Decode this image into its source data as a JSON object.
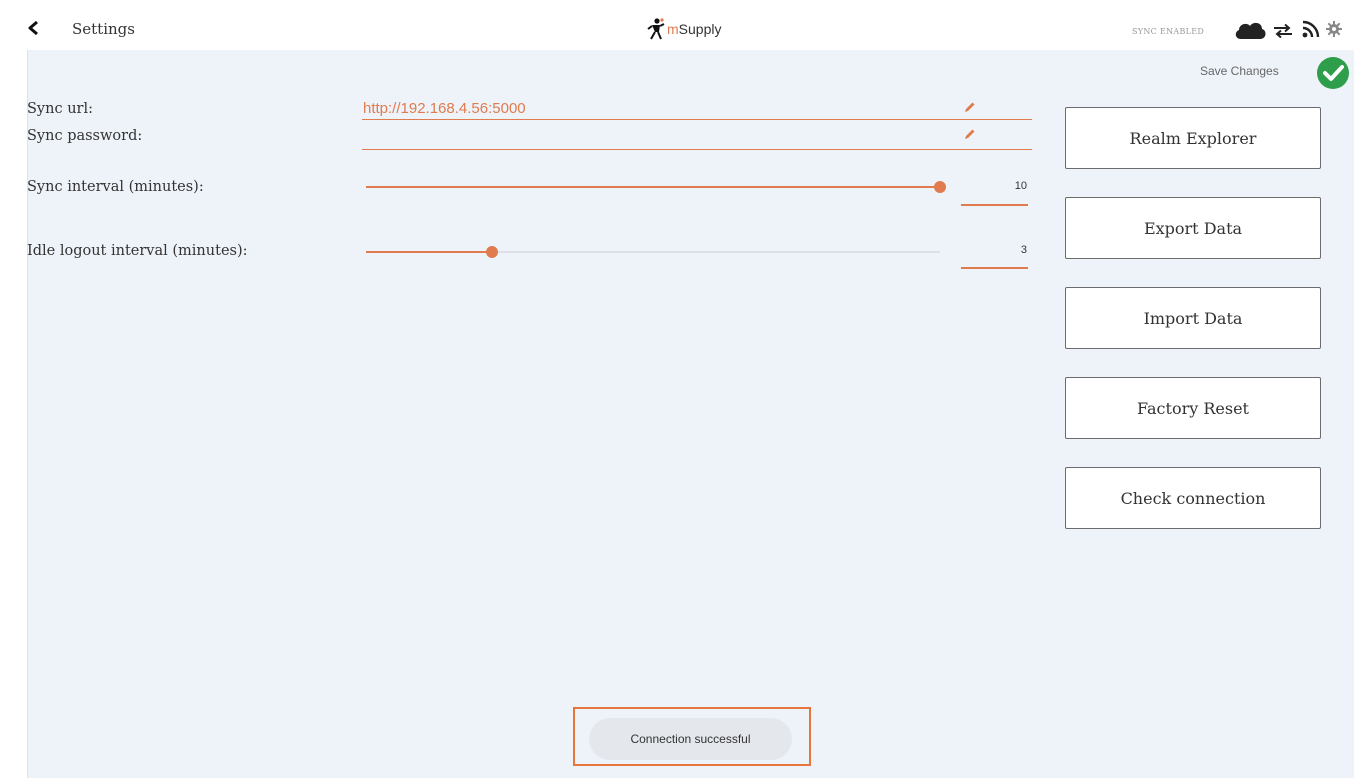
{
  "header": {
    "title": "Settings",
    "logo_m": "m",
    "logo_rest": "Supply",
    "sync_status": "SYNC ENABLED",
    "icons": [
      "back-icon",
      "mosquito-logo-icon",
      "cloud-icon",
      "swap-arrows-icon",
      "wifi-signal-icon",
      "gear-icon"
    ]
  },
  "save": {
    "label": "Save Changes",
    "icon": "check-circle-icon",
    "color": "#2e9e4a"
  },
  "form": {
    "sync_url": {
      "label": "Sync url:",
      "value": "http://192.168.4.56:5000"
    },
    "sync_password": {
      "label": "Sync password:",
      "value": ""
    },
    "sync_interval": {
      "label": "Sync interval (minutes):",
      "value": "10",
      "slider_fraction": 1.0
    },
    "idle_logout": {
      "label": "Idle logout interval (minutes):",
      "value": "3",
      "slider_fraction": 0.22
    }
  },
  "buttons": {
    "realm_explorer": "Realm Explorer",
    "export_data": "Export Data",
    "import_data": "Import Data",
    "factory_reset": "Factory Reset",
    "check_connection": "Check connection"
  },
  "toast": {
    "message": "Connection successful"
  },
  "colors": {
    "accent": "#e07b4d",
    "panel_bg": "#eef3fa",
    "toast_outline": "#e8753c"
  }
}
